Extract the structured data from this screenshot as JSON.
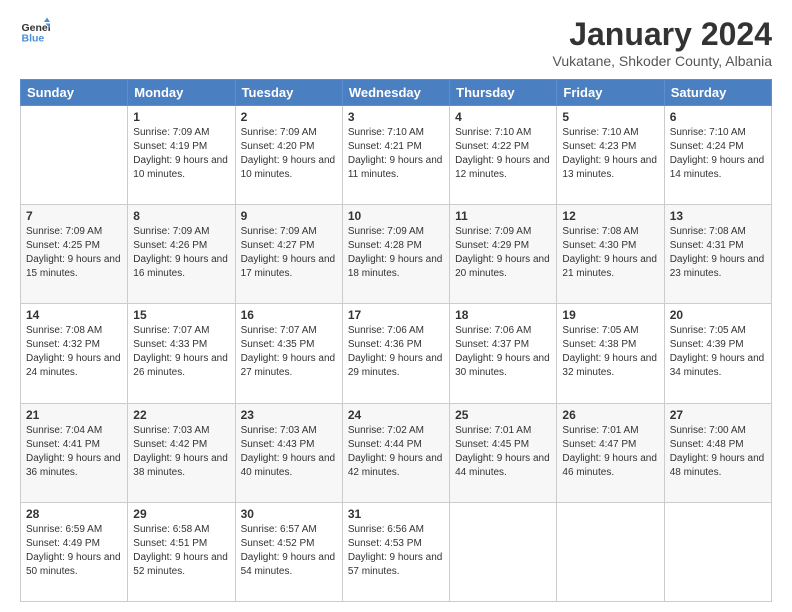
{
  "header": {
    "logo_line1": "General",
    "logo_line2": "Blue",
    "month_title": "January 2024",
    "subtitle": "Vukatane, Shkoder County, Albania"
  },
  "days_of_week": [
    "Sunday",
    "Monday",
    "Tuesday",
    "Wednesday",
    "Thursday",
    "Friday",
    "Saturday"
  ],
  "weeks": [
    [
      {
        "day": "",
        "sunrise": "",
        "sunset": "",
        "daylight": ""
      },
      {
        "day": "1",
        "sunrise": "7:09 AM",
        "sunset": "4:19 PM",
        "daylight": "9 hours and 10 minutes."
      },
      {
        "day": "2",
        "sunrise": "7:09 AM",
        "sunset": "4:20 PM",
        "daylight": "9 hours and 10 minutes."
      },
      {
        "day": "3",
        "sunrise": "7:10 AM",
        "sunset": "4:21 PM",
        "daylight": "9 hours and 11 minutes."
      },
      {
        "day": "4",
        "sunrise": "7:10 AM",
        "sunset": "4:22 PM",
        "daylight": "9 hours and 12 minutes."
      },
      {
        "day": "5",
        "sunrise": "7:10 AM",
        "sunset": "4:23 PM",
        "daylight": "9 hours and 13 minutes."
      },
      {
        "day": "6",
        "sunrise": "7:10 AM",
        "sunset": "4:24 PM",
        "daylight": "9 hours and 14 minutes."
      }
    ],
    [
      {
        "day": "7",
        "sunrise": "7:09 AM",
        "sunset": "4:25 PM",
        "daylight": "9 hours and 15 minutes."
      },
      {
        "day": "8",
        "sunrise": "7:09 AM",
        "sunset": "4:26 PM",
        "daylight": "9 hours and 16 minutes."
      },
      {
        "day": "9",
        "sunrise": "7:09 AM",
        "sunset": "4:27 PM",
        "daylight": "9 hours and 17 minutes."
      },
      {
        "day": "10",
        "sunrise": "7:09 AM",
        "sunset": "4:28 PM",
        "daylight": "9 hours and 18 minutes."
      },
      {
        "day": "11",
        "sunrise": "7:09 AM",
        "sunset": "4:29 PM",
        "daylight": "9 hours and 20 minutes."
      },
      {
        "day": "12",
        "sunrise": "7:08 AM",
        "sunset": "4:30 PM",
        "daylight": "9 hours and 21 minutes."
      },
      {
        "day": "13",
        "sunrise": "7:08 AM",
        "sunset": "4:31 PM",
        "daylight": "9 hours and 23 minutes."
      }
    ],
    [
      {
        "day": "14",
        "sunrise": "7:08 AM",
        "sunset": "4:32 PM",
        "daylight": "9 hours and 24 minutes."
      },
      {
        "day": "15",
        "sunrise": "7:07 AM",
        "sunset": "4:33 PM",
        "daylight": "9 hours and 26 minutes."
      },
      {
        "day": "16",
        "sunrise": "7:07 AM",
        "sunset": "4:35 PM",
        "daylight": "9 hours and 27 minutes."
      },
      {
        "day": "17",
        "sunrise": "7:06 AM",
        "sunset": "4:36 PM",
        "daylight": "9 hours and 29 minutes."
      },
      {
        "day": "18",
        "sunrise": "7:06 AM",
        "sunset": "4:37 PM",
        "daylight": "9 hours and 30 minutes."
      },
      {
        "day": "19",
        "sunrise": "7:05 AM",
        "sunset": "4:38 PM",
        "daylight": "9 hours and 32 minutes."
      },
      {
        "day": "20",
        "sunrise": "7:05 AM",
        "sunset": "4:39 PM",
        "daylight": "9 hours and 34 minutes."
      }
    ],
    [
      {
        "day": "21",
        "sunrise": "7:04 AM",
        "sunset": "4:41 PM",
        "daylight": "9 hours and 36 minutes."
      },
      {
        "day": "22",
        "sunrise": "7:03 AM",
        "sunset": "4:42 PM",
        "daylight": "9 hours and 38 minutes."
      },
      {
        "day": "23",
        "sunrise": "7:03 AM",
        "sunset": "4:43 PM",
        "daylight": "9 hours and 40 minutes."
      },
      {
        "day": "24",
        "sunrise": "7:02 AM",
        "sunset": "4:44 PM",
        "daylight": "9 hours and 42 minutes."
      },
      {
        "day": "25",
        "sunrise": "7:01 AM",
        "sunset": "4:45 PM",
        "daylight": "9 hours and 44 minutes."
      },
      {
        "day": "26",
        "sunrise": "7:01 AM",
        "sunset": "4:47 PM",
        "daylight": "9 hours and 46 minutes."
      },
      {
        "day": "27",
        "sunrise": "7:00 AM",
        "sunset": "4:48 PM",
        "daylight": "9 hours and 48 minutes."
      }
    ],
    [
      {
        "day": "28",
        "sunrise": "6:59 AM",
        "sunset": "4:49 PM",
        "daylight": "9 hours and 50 minutes."
      },
      {
        "day": "29",
        "sunrise": "6:58 AM",
        "sunset": "4:51 PM",
        "daylight": "9 hours and 52 minutes."
      },
      {
        "day": "30",
        "sunrise": "6:57 AM",
        "sunset": "4:52 PM",
        "daylight": "9 hours and 54 minutes."
      },
      {
        "day": "31",
        "sunrise": "6:56 AM",
        "sunset": "4:53 PM",
        "daylight": "9 hours and 57 minutes."
      },
      {
        "day": "",
        "sunrise": "",
        "sunset": "",
        "daylight": ""
      },
      {
        "day": "",
        "sunrise": "",
        "sunset": "",
        "daylight": ""
      },
      {
        "day": "",
        "sunrise": "",
        "sunset": "",
        "daylight": ""
      }
    ]
  ]
}
